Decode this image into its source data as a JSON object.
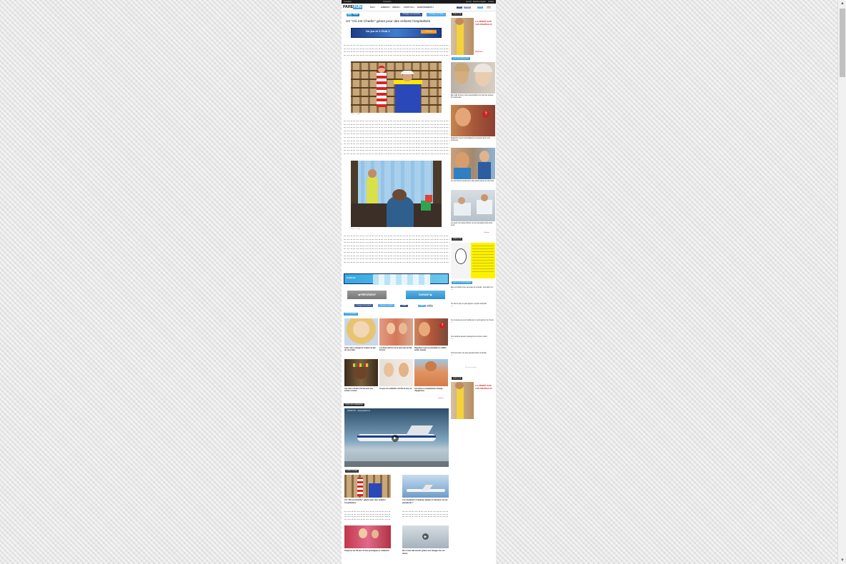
{
  "topbar": {
    "left": [
      "Inscription",
      "Connexion"
    ],
    "right": [
      "Accueil",
      "Mentions légales",
      "Contact"
    ]
  },
  "header": {
    "logo_a": "PARE",
    "logo_b": "FUN",
    "nav": [
      "FUN ▾",
      "HUMOUR ▾",
      "VIDÉOS ▾",
      "LIFESTYLE ▾",
      "DIVERTISSEMENT ▾"
    ],
    "social": [
      "J'aime",
      "Partager",
      "Suivre",
      "G+1"
    ]
  },
  "article": {
    "tags": [
      "FUN",
      "VIDÉO"
    ],
    "share_fb": "Partager sur Facebook",
    "share_tw": "Partager sur Twitter",
    "title": "Un \"Où est Charlie\" géant pour des enfants hospitalisés",
    "banner": {
      "text": "Un jeu et 1 Club 1",
      "cta": "Découvrir"
    },
    "photo1_caption": "Source : reddit",
    "photo2_caption": "Source : reddit",
    "ad": {
      "text": "Publicité"
    },
    "prev": "PRÉCÉDENT",
    "next": "SUIVANT",
    "share2": [
      "Partager sur Facebook",
      "Partager sur Twitter"
    ],
    "share2_counts": [
      "J'aime",
      "0",
      "Tweet",
      "G+1",
      "0",
      "Partager"
    ]
  },
  "related": {
    "label": "VOUS AIMEREZ",
    "items": [
      {
        "title": "Cette robe a changé de couleur au lieu de vous faire...",
        "src": "Parefun"
      },
      {
        "title": "Les deux actrices de la série qui ont fait le buzz",
        "src": "Parefun"
      },
      {
        "title": "Regardez à quoi ressemblait ce célèbre acteur d'avant",
        "src": "Parefun"
      },
      {
        "title": "Ces stars ont été à l'école avec des acteurs connus",
        "src": "Parefun"
      },
      {
        "title": "Ce que ces célébrités ont fait de leur vie",
        "src": "Parefun"
      },
      {
        "title": "Cet acteur a complètement changé d'apparence",
        "src": "Parefun"
      }
    ],
    "ad_marker": "Outbrain"
  },
  "video": {
    "label": "VIDÉO RECOMMANDÉE",
    "title": "FROM UK - www.parefun.tv"
  },
  "latest": {
    "label": "À DÉCOUVRIR",
    "items": [
      {
        "title": "Un \"Où est Charlie\" géant pour des enfants hospitalisés",
        "meta": "Fun"
      },
      {
        "title": "Les incidents à Sydney depuis le fameux vol de pandémie ?",
        "meta": "Fun"
      },
      {
        "title": "Surprise au 30 ans d'une prestigieuse célébrité",
        "meta": "Fun"
      },
      {
        "title": "On a tout découvert grâce aux images de cet avion",
        "meta": "Fun"
      }
    ]
  },
  "sidebar": {
    "label1": "PUBLICITÉ",
    "ad1": {
      "text": "LA VÉRITÉ SUR LES DRAPEAUX",
      "sub": "Réponses"
    },
    "label2": "À NE PAS MANQUER",
    "items": [
      {
        "title": "Elle avait 94 ans et elle ressemblait à une star des années 30 maintenant"
      },
      {
        "title": "Regardez à quoi ressemblaient ces acteurs qu'on voit beaucoup"
      },
      {
        "title": "Ce vieil homme aurait été le plus grand acteur qui ait existé"
      },
      {
        "title": "Les gens ont réussi à filmer ce qui s'est passé dans cette école"
      }
    ],
    "marker": "Outbrain",
    "label3": "PUBLICITÉ",
    "label4": "LES PLUS POPULAIRES",
    "feats": [
      {
        "title": "Elle est coiffée d'une perruque de comédie, vous allez rire",
        "meta": "Fun"
      },
      {
        "title": "Un fois de plus ce petit garçon a surpris la famille",
        "meta": "Fun"
      },
      {
        "title": "Ce nouveau jeu a été réalisé par un petit garçon de 10 ans",
        "meta": "Fun"
      },
      {
        "title": "Ces célèbres acteurs partagent leur ancien métier",
        "meta": "Fun"
      },
      {
        "title": "Comment faire vos plus grands photos de famille",
        "meta": "Fun"
      }
    ],
    "more": "Voir plus d'articles",
    "label5": "PUBLICITÉ"
  }
}
